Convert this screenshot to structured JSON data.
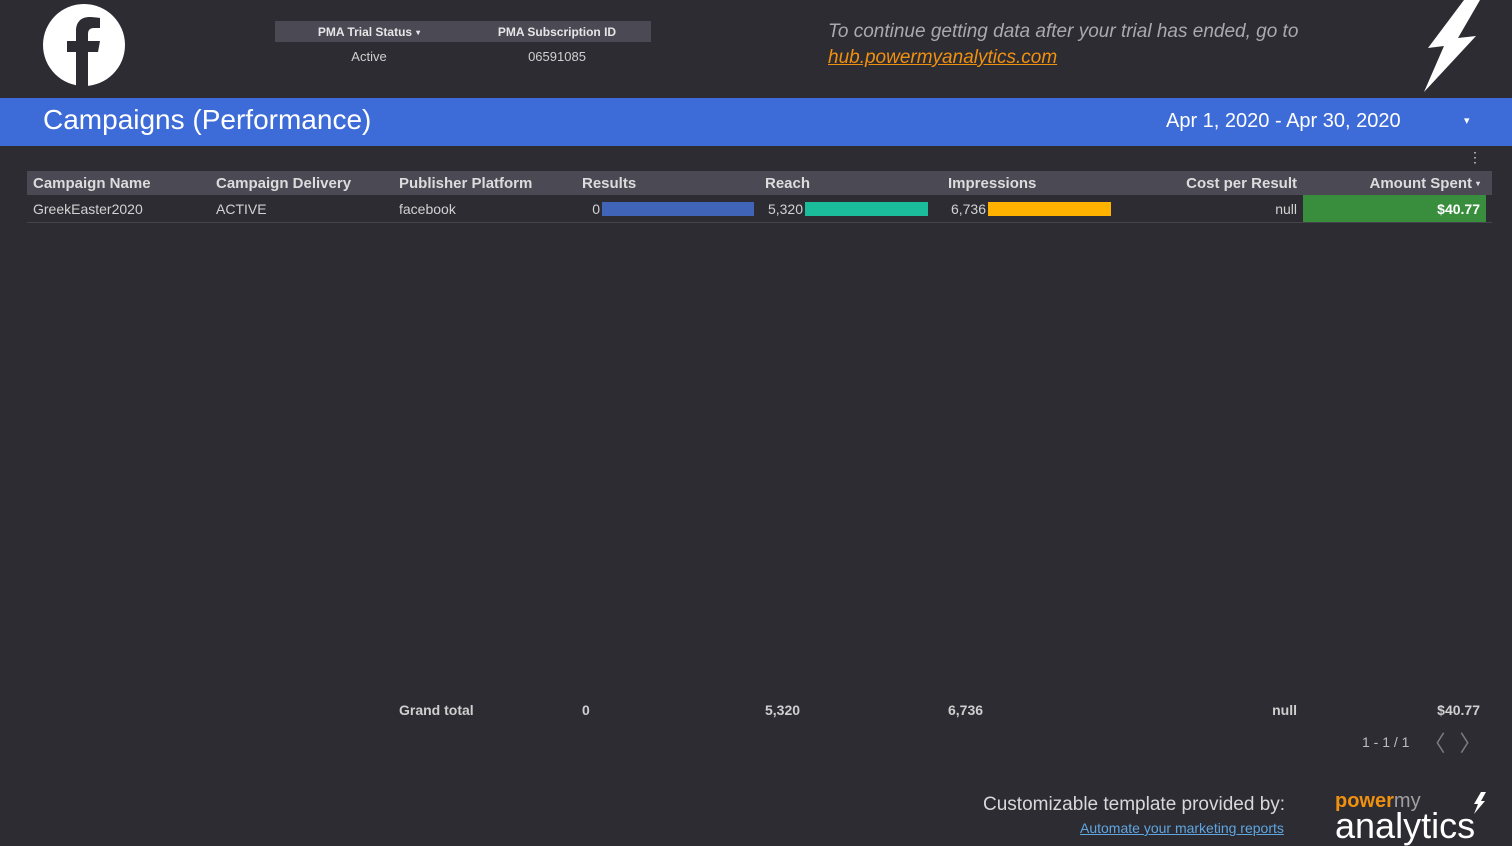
{
  "header": {
    "logo_icon": "facebook-logo-icon",
    "status_table": {
      "columns": [
        "PMA Trial Status",
        "PMA Subscription ID"
      ],
      "values": [
        "Active",
        "06591085"
      ],
      "sort_indicator": "▾"
    },
    "notice_text": "To continue getting data after your trial has ended, go to",
    "notice_link": "hub.powermyanalytics.com",
    "bolt_icon": "lightning-bolt-icon"
  },
  "banner": {
    "title": "Campaigns (Performance)",
    "date_range": "Apr 1, 2020 - Apr 30, 2020",
    "date_caret": "▾"
  },
  "table": {
    "menu_icon": "⋮",
    "columns": [
      "Campaign Name",
      "Campaign Delivery",
      "Publisher Platform",
      "Results",
      "Reach",
      "Impressions",
      "Cost per Result",
      "Amount Spent"
    ],
    "sort_indicator": "▾",
    "rows": [
      {
        "campaign_name": "GreekEaster2020",
        "delivery": "ACTIVE",
        "platform": "facebook",
        "results": "0",
        "reach": "5,320",
        "impressions": "6,736",
        "cost_per_result": "null",
        "amount_spent": "$40.77"
      }
    ],
    "bar_colors": {
      "results": "#3f64b8",
      "reach": "#1abc9c",
      "impressions": "#ffb300",
      "spent": "#388e3c"
    },
    "grand_total": {
      "label": "Grand total",
      "results": "0",
      "reach": "5,320",
      "impressions": "6,736",
      "cost_per_result": "null",
      "amount_spent": "$40.77"
    },
    "pagination": {
      "text": "1 - 1 / 1",
      "prev": "〈",
      "next": "〉"
    }
  },
  "footer": {
    "credit_text": "Customizable template provided by:",
    "credit_link": "Automate your marketing reports",
    "brand_power": "power",
    "brand_my": "my",
    "brand_analytics": "analytics"
  }
}
